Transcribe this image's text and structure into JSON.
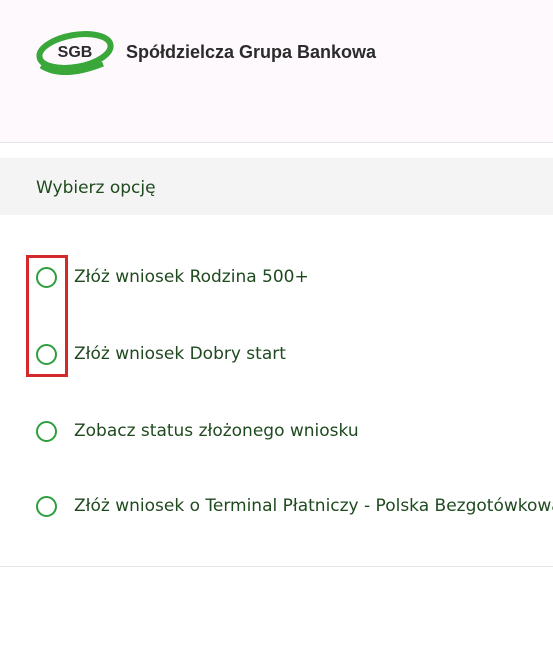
{
  "brand": {
    "logo_text": "SGB",
    "name": "Spółdzielcza Grupa Bankowa"
  },
  "section": {
    "title": "Wybierz opcję"
  },
  "options": [
    {
      "label": "Złóż wniosek Rodzina 500+",
      "selected": false
    },
    {
      "label": "Złóż wniosek Dobry start",
      "selected": false
    },
    {
      "label": "Zobacz status złożonego wniosku",
      "selected": false
    },
    {
      "label": "Złóż wniosek o Terminal Płatniczy - Polska Bezgotówkowa",
      "selected": false
    }
  ],
  "colors": {
    "accent_green": "#2e9e3f",
    "text_green": "#1f4a1f",
    "highlight_red": "#d62828"
  }
}
